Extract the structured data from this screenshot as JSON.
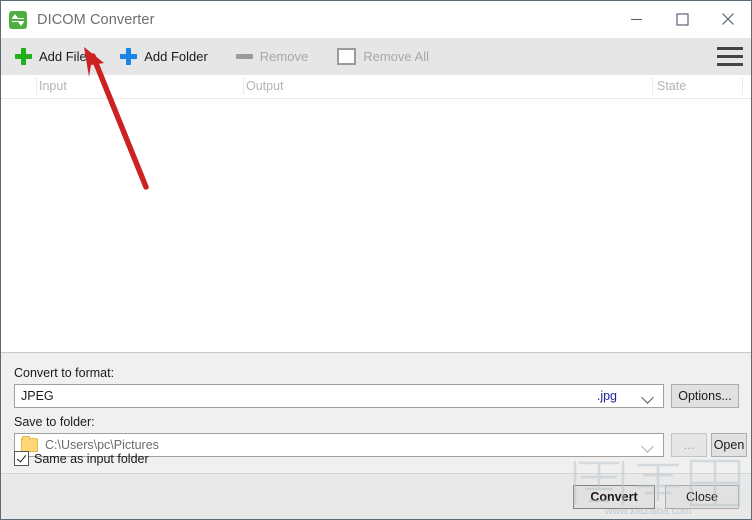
{
  "window": {
    "title": "DICOM Converter",
    "app_icon": "convert-arrows-icon",
    "minimize_label": "–",
    "maximize_label": "□",
    "close_label": "✕"
  },
  "toolbar": {
    "add_files": "Add Files",
    "add_folder": "Add Folder",
    "remove": "Remove",
    "remove_all": "Remove All",
    "menu_icon": "hamburger-menu-icon"
  },
  "list": {
    "columns": [
      "Input",
      "Output",
      "State"
    ],
    "rows": []
  },
  "settings": {
    "format_label": "Convert to format:",
    "format_value": "JPEG",
    "format_extension": ".jpg",
    "options_button": "Options...",
    "folder_label": "Save to folder:",
    "folder_value": "C:\\Users\\pc\\Pictures",
    "browse_button": "...",
    "open_button": "Open",
    "same_as_input_label": "Same as input folder",
    "same_as_input_checked": true
  },
  "footer": {
    "convert_button": "Convert",
    "close_button": "Close"
  },
  "watermark": {
    "site": "www.xiazaiba.com",
    "brand": "下载吧"
  },
  "annotation": {
    "type": "red-arrow",
    "points_to": "Add Files"
  },
  "colors": {
    "accent_green": "#21b01e",
    "accent_blue": "#1b84e7",
    "extension_blue": "#22229c",
    "annotation_red": "#cc2222",
    "toolbar_bg": "#e6e6e6",
    "panel_bg": "#f0f0f0"
  }
}
